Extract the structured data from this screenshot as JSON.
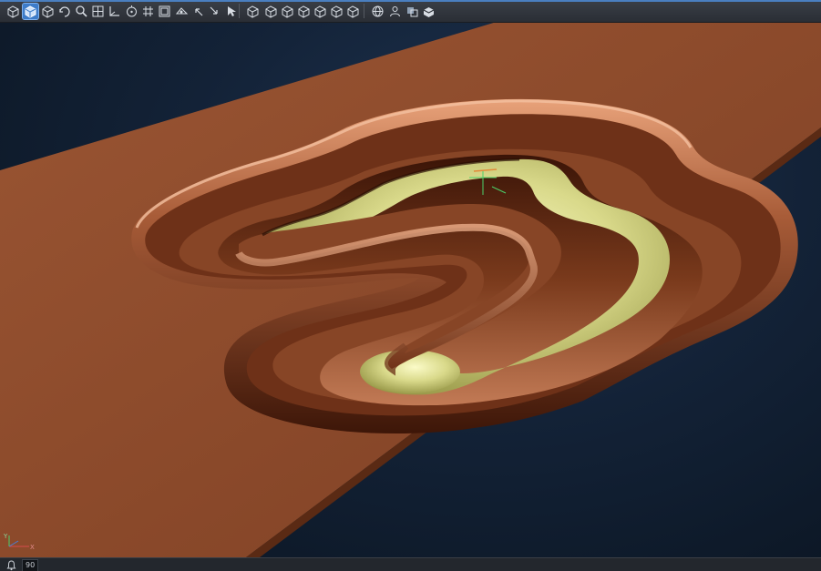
{
  "toolbar": {
    "buttons": [
      {
        "name": "view-iso-wire-icon",
        "active": false
      },
      {
        "name": "view-iso-shaded-icon",
        "active": true
      },
      {
        "name": "view-box-icon",
        "active": false
      },
      {
        "name": "rotate-view-icon",
        "active": false
      },
      {
        "name": "zoom-icon",
        "active": false
      },
      {
        "name": "zoom-extents-icon",
        "active": false
      },
      {
        "name": "axis-icon",
        "active": false
      },
      {
        "name": "rotate-center-icon",
        "active": false
      },
      {
        "name": "grid-icon",
        "active": false
      },
      {
        "name": "frame-icon",
        "active": false
      },
      {
        "name": "section-icon",
        "active": false
      },
      {
        "name": "undo-view-icon",
        "active": false
      },
      {
        "name": "redo-view-icon",
        "active": false
      },
      {
        "name": "select-icon",
        "active": false
      },
      {
        "name": "view-top-icon",
        "active": false
      },
      {
        "name": "view-front-icon",
        "active": false
      },
      {
        "name": "view-back-icon",
        "active": false
      },
      {
        "name": "view-left-icon",
        "active": false
      },
      {
        "name": "view-right-icon",
        "active": false
      },
      {
        "name": "view-bottom-icon",
        "active": false
      },
      {
        "name": "view-iso-icon",
        "active": false
      },
      {
        "name": "globe-icon",
        "active": false
      },
      {
        "name": "user-view-icon",
        "active": false
      },
      {
        "name": "shading-options-icon",
        "active": false
      },
      {
        "name": "material-icon",
        "active": false
      }
    ]
  },
  "statusbar": {
    "field_value": "90"
  },
  "triad": {
    "x_label": "X",
    "y_label": "Y"
  },
  "colors": {
    "part": "#8b4a2b",
    "pocket_floor": "#d7d888",
    "background": "#132237"
  }
}
